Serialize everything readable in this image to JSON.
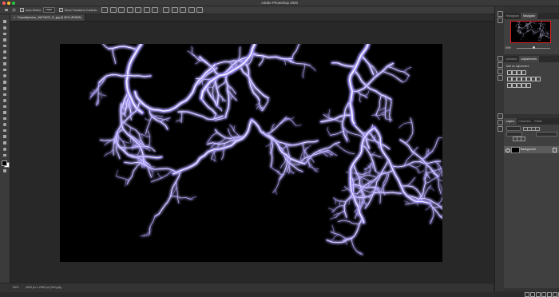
{
  "app": {
    "title": "Adobe Photoshop 2020"
  },
  "colors": {
    "traffic_close": "#ff5f57",
    "traffic_min": "#febc2e",
    "traffic_max": "#28c840",
    "nav_frame": "#e02020",
    "bolt_glow": "#9a8cff"
  },
  "options_bar": {
    "auto_select_label": "Auto-Select:",
    "auto_select_value": "Layer",
    "transform_controls_label": "Show Transform Controls"
  },
  "document": {
    "tab_title": "Depositphotos_16074022_l2_jpg @ 50% (RGB/8)",
    "close_glyph": "×"
  },
  "status": {
    "zoom": "50%",
    "doc_info": "4000 px x 2250 px (240 ppi)"
  },
  "panels": {
    "top_tabs": [
      "Histogram",
      "Navigator"
    ],
    "nav_zoom": "50%",
    "mid_tabs": [
      "Libraries",
      "Adjustments"
    ],
    "adjustments_label": "Add an adjustment",
    "layer_tabs": [
      "Layers",
      "Channels",
      "Paths"
    ],
    "layer_name": "Background"
  }
}
